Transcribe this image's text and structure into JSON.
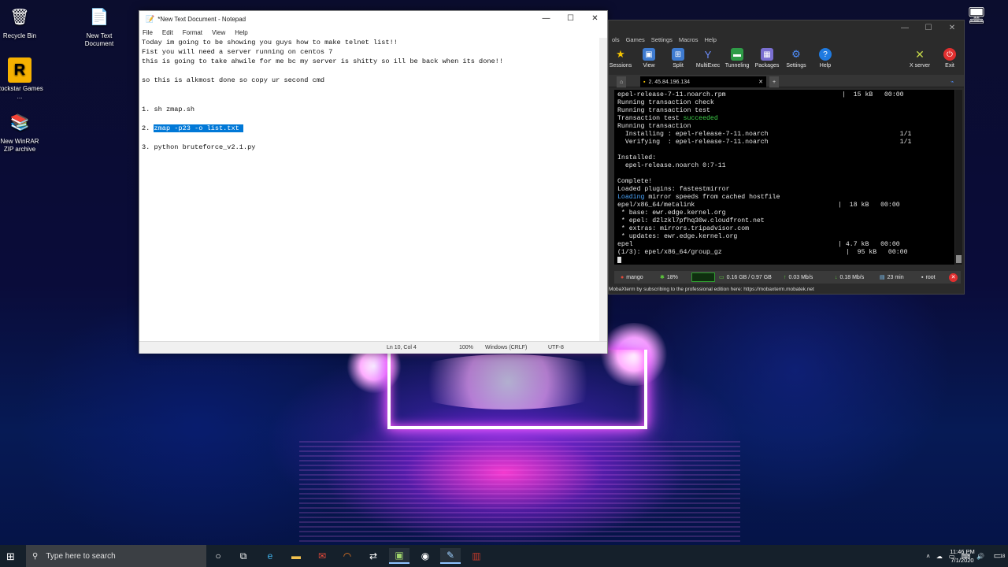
{
  "desktop": {
    "icons": [
      {
        "label": "Recycle Bin",
        "icon": "recycle-bin-icon"
      },
      {
        "label": "New Text Document",
        "icon": "text-document-icon"
      },
      {
        "label": "Rockstar Games ...",
        "icon": "rockstar-games-icon"
      },
      {
        "label": "New WinRAR ZIP archive",
        "icon": "winrar-archive-icon"
      }
    ]
  },
  "notepad": {
    "title": "*New Text Document - Notepad",
    "menu": [
      "File",
      "Edit",
      "Format",
      "View",
      "Help"
    ],
    "lines": [
      "Today im going to be showing you guys how to make telnet list!!",
      "Fist you will need a server running on centos 7",
      "this is going to take ahwile for me bc my server is shitty so ill be back when its done!!",
      "",
      "so this is alkmost done so copy ur second cmd",
      "",
      "",
      "1. sh zmap.sh",
      "",
      "2. ",
      "",
      "3. python bruteforce_v2.1.py"
    ],
    "selected_text": "zmap -p23 -o list.txt ",
    "status": {
      "position": "Ln 10, Col 4",
      "zoom": "100%",
      "line_ending": "Windows (CRLF)",
      "encoding": "UTF-8"
    }
  },
  "mobaxterm": {
    "menu": [
      "ols",
      "Games",
      "Settings",
      "Macros",
      "Help"
    ],
    "toolbar": [
      "Sessions",
      "View",
      "Split",
      "MultiExec",
      "Tunneling",
      "Packages",
      "Settings",
      "Help",
      "X server",
      "Exit"
    ],
    "tab_label": "2. 45.84.196.134",
    "terminal_lines": [
      {
        "text": "epel-release-7-11.noarch.rpm                              |  15 kB   00:00"
      },
      {
        "text": "Running transaction check"
      },
      {
        "text": "Running transaction test"
      },
      {
        "text": "Transaction test ",
        "highlight": "succeeded",
        "highlight_color": "green"
      },
      {
        "text": "Running transaction"
      },
      {
        "text": "  Installing : epel-release-7-11.noarch                                  1/1"
      },
      {
        "text": "  Verifying  : epel-release-7-11.noarch                                  1/1"
      },
      {
        "text": ""
      },
      {
        "text": "Installed:"
      },
      {
        "text": "  epel-release.noarch 0:7-11"
      },
      {
        "text": ""
      },
      {
        "text": "Complete!"
      },
      {
        "text": "Loaded plugins: fastestmirror"
      },
      {
        "text": "",
        "highlight": "Loading",
        "highlight_color": "blue",
        "rest": " mirror speeds from cached hostfile"
      },
      {
        "text": "epel/x86_64/metalink                                     |  18 kB   00:00"
      },
      {
        "text": " * base: ewr.edge.kernel.org"
      },
      {
        "text": " * epel: d2lzkl7pfhq30w.cloudfront.net"
      },
      {
        "text": " * extras: mirrors.tripadvisor.com"
      },
      {
        "text": " * updates: ewr.edge.kernel.org"
      },
      {
        "text": "epel                                                     | 4.7 kB   00:00"
      },
      {
        "text": "(1/3): epel/x86_64/group_gz                                |  95 kB   00:00"
      }
    ],
    "statusbar": {
      "host": "mango",
      "cpu": "18%",
      "memory": "0.16 GB / 0.97 GB",
      "upload": "0.03 Mb/s",
      "download": "0.18 Mb/s",
      "uptime": "23 min",
      "user": "root"
    },
    "unregistered_notice": "MobaXterm by subscribing to the professional edition here:  https://mobaxterm.mobatek.net"
  },
  "taskbar": {
    "search_placeholder": "Type here to search",
    "time": "11:46 PM",
    "date": "7/1/2020",
    "notification_count": "18"
  }
}
